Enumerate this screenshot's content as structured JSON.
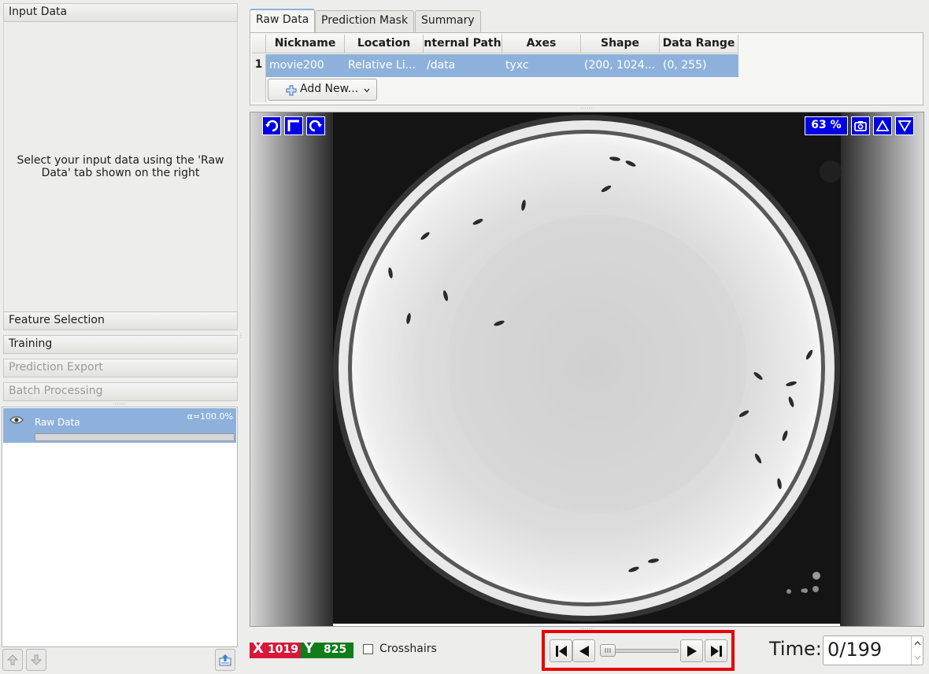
{
  "drawer": {
    "input_data": "Input Data",
    "instructions": "Select your input data using the 'Raw Data' tab shown on the right",
    "feature_selection": "Feature Selection",
    "training": "Training",
    "prediction_export": "Prediction Export",
    "batch_processing": "Batch Processing"
  },
  "layers": {
    "items": [
      {
        "name": "Raw Data",
        "alpha": "α=100.0%",
        "visible": true,
        "opacity": 1.0
      }
    ]
  },
  "tabs": [
    {
      "label": "Raw Data",
      "active": true
    },
    {
      "label": "Prediction Mask",
      "active": false
    },
    {
      "label": "Summary",
      "active": false
    }
  ],
  "dataset_table": {
    "columns": [
      "Nickname",
      "Location",
      "nternal Path",
      "Axes",
      "Shape",
      "Data Range"
    ],
    "rows": [
      {
        "index": "1",
        "nickname": "movie200",
        "location": "Relative Li...",
        "internal_path": "/data",
        "axes": "tyxc",
        "shape": "(200, 1024...",
        "data_range": "(0, 255)"
      }
    ],
    "add_button": "Add New..."
  },
  "viewer": {
    "zoom": "63 %",
    "icons": [
      "undo-icon",
      "fit-icon",
      "redo-icon",
      "camera-icon",
      "up-triangle-icon",
      "down-triangle-icon"
    ]
  },
  "status": {
    "x_axis": "X",
    "x_value": "1019",
    "y_axis": "Y",
    "y_value": "825",
    "x_color": "#d6193a",
    "y_color": "#0f7d1a",
    "crosshairs_label": "Crosshairs",
    "crosshairs_checked": false
  },
  "player": {
    "time_label": "Time:",
    "time_value": "0/199",
    "position_fraction": 0.0,
    "highlight_color": "#e60000"
  }
}
